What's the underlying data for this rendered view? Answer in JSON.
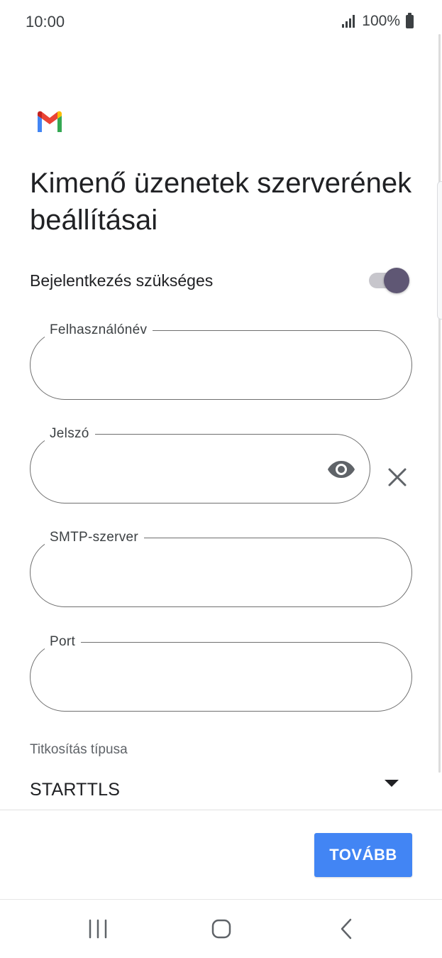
{
  "status_bar": {
    "time": "10:00",
    "battery": "100%"
  },
  "page": {
    "title": "Kimenő üzenetek szerverének beállításai"
  },
  "login_toggle": {
    "label": "Bejelentkezés szükséges",
    "state": "on"
  },
  "fields": {
    "username": {
      "label": "Felhasználónév",
      "value": ""
    },
    "password": {
      "label": "Jelszó",
      "value": ""
    },
    "smtp_server": {
      "label": "SMTP-szerver",
      "value": ""
    },
    "port": {
      "label": "Port",
      "value": ""
    }
  },
  "encryption": {
    "label": "Titkosítás típusa",
    "selected": "STARTTLS"
  },
  "actions": {
    "next_label": "TOVÁBB"
  },
  "icons": {
    "app_logo": "gmail-logo",
    "password_visibility": "eye-icon",
    "clear": "close-icon",
    "nav_recents": "recents-icon",
    "nav_home": "home-icon",
    "nav_back": "back-icon"
  },
  "colors": {
    "primary_button": "#4285f4",
    "toggle_thumb": "#5f5774",
    "field_border": "#6f6f6f"
  }
}
